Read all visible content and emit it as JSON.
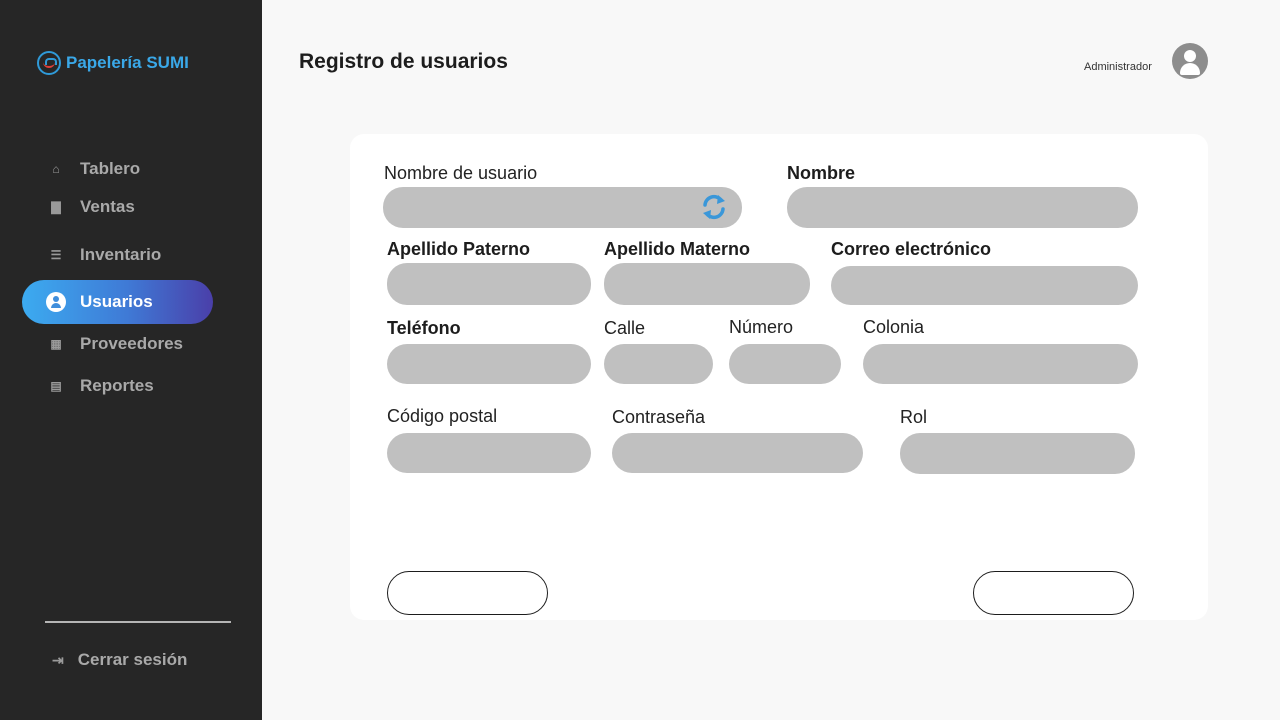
{
  "brand": {
    "name": "Papelería SUMI",
    "logo_icon": "stationery-logo-icon",
    "accent": "#3aa8e8"
  },
  "sidebar": {
    "items": [
      {
        "label": "Tablero",
        "icon": "home-icon"
      },
      {
        "label": "Ventas",
        "icon": "bar-chart-icon"
      },
      {
        "label": "Inventario",
        "icon": "document-icon"
      },
      {
        "label": "Usuarios",
        "icon": "user-circle-icon",
        "active": true
      },
      {
        "label": "Proveedores",
        "icon": "box-icon"
      },
      {
        "label": "Reportes",
        "icon": "report-icon"
      }
    ],
    "logout": {
      "label": "Cerrar sesión",
      "icon": "logout-icon"
    },
    "background": "#262626"
  },
  "header": {
    "title": "Registro de usuarios",
    "role": "Administrador",
    "avatar_icon": "user-avatar-icon"
  },
  "form": {
    "username": {
      "label": "Nombre de usuario",
      "value": ""
    },
    "first_name": {
      "label": "Nombre",
      "value": ""
    },
    "last_name_paternal": {
      "label": "Apellido Paterno",
      "value": ""
    },
    "last_name_maternal": {
      "label": "Apellido Materno",
      "value": ""
    },
    "email": {
      "label": "Correo electrónico",
      "value": ""
    },
    "phone": {
      "label": "Teléfono",
      "value": ""
    },
    "street": {
      "label": "Calle",
      "value": ""
    },
    "number": {
      "label": "Número",
      "value": ""
    },
    "neighborhood": {
      "label": "Colonia",
      "value": ""
    },
    "postal_code": {
      "label": "Código postal",
      "value": ""
    },
    "password": {
      "label": "Contraseña",
      "value": ""
    },
    "role": {
      "label": "Rol",
      "value": ""
    },
    "refresh_icon": "refresh-icon",
    "left_button_label": "",
    "right_button_label": "",
    "field_color": "#c0c0c0"
  }
}
